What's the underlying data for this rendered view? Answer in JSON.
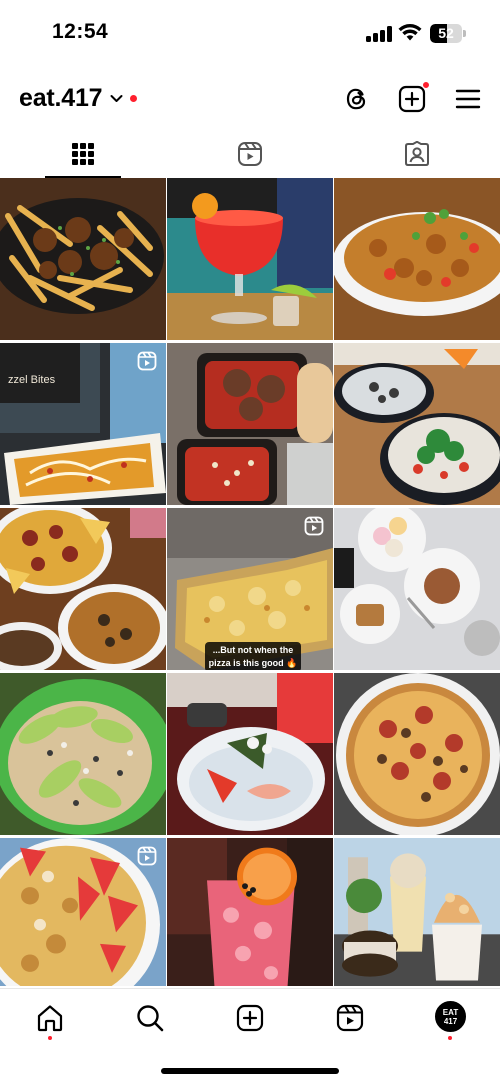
{
  "status_bar": {
    "time": "12:54",
    "battery": "52",
    "battery_level": 0.52
  },
  "header": {
    "username": "eat.417",
    "has_notification": true
  },
  "tabs": [
    {
      "icon": "grid-icon",
      "active": true
    },
    {
      "icon": "reels-icon",
      "active": false
    },
    {
      "icon": "tagged-icon",
      "active": false
    }
  ],
  "posts": [
    {
      "id": 1,
      "subject": "loaded fries with chicken",
      "reel": false
    },
    {
      "id": 2,
      "subject": "red margarita drink",
      "reel": false
    },
    {
      "id": 3,
      "subject": "fried rice dish",
      "reel": false
    },
    {
      "id": 4,
      "subject": "nachos fries tray",
      "reel": true
    },
    {
      "id": 5,
      "subject": "meatballs and marinara",
      "reel": false
    },
    {
      "id": 6,
      "subject": "salad bowls",
      "reel": false
    },
    {
      "id": 7,
      "subject": "nachos platter",
      "reel": false
    },
    {
      "id": 8,
      "subject": "cheese pizza",
      "reel": true,
      "caption": "...But not when the pizza is this good 🔥"
    },
    {
      "id": 9,
      "subject": "desserts table",
      "reel": false
    },
    {
      "id": 10,
      "subject": "avocado tostadas",
      "reel": false
    },
    {
      "id": 11,
      "subject": "sushi plate",
      "reel": false
    },
    {
      "id": 12,
      "subject": "pepperoni pizza",
      "reel": false
    },
    {
      "id": 13,
      "subject": "strawberry granola bowl",
      "reel": true
    },
    {
      "id": 14,
      "subject": "pink cocktail",
      "reel": false
    },
    {
      "id": 15,
      "subject": "ice cream treats",
      "reel": false
    }
  ],
  "bottom_nav": {
    "items": [
      "home-icon",
      "search-icon",
      "create-icon",
      "reels-icon",
      "profile-avatar"
    ],
    "avatar_text": "EAT 417"
  },
  "colors": {
    "notification": "#ff1f2d",
    "text": "#000000"
  }
}
